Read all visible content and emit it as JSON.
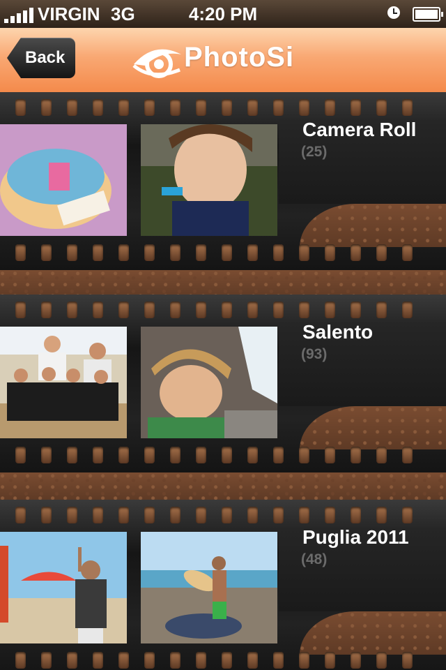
{
  "status_bar": {
    "carrier": "VIRGIN",
    "network": "3G",
    "time": "4:20 PM"
  },
  "nav": {
    "back_label": "Back",
    "logo_text": "PhotoSi"
  },
  "albums": [
    {
      "title": "Camera Roll",
      "count": "(25)"
    },
    {
      "title": "Salento",
      "count": "(93)"
    },
    {
      "title": "Puglia 2011",
      "count": "(48)"
    }
  ],
  "colors": {
    "nav_top": "#fdd5ae",
    "nav_bottom": "#f48a4b",
    "film": "#1f1f1f",
    "leather": "#6e4530"
  }
}
